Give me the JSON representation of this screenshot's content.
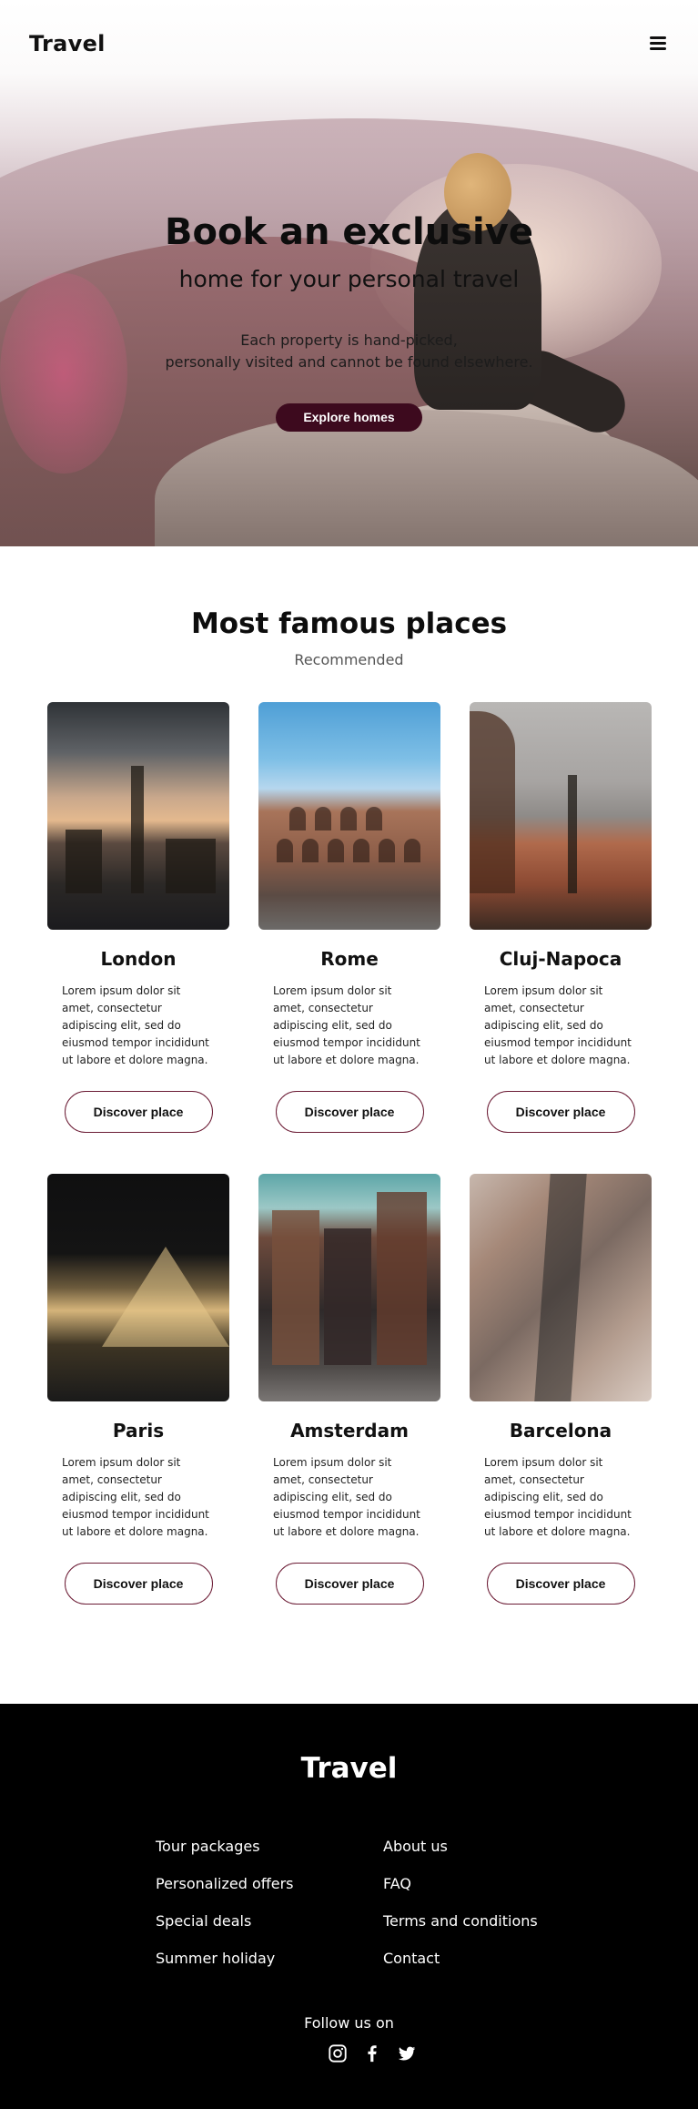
{
  "nav": {
    "logo": "Travel",
    "menu_icon": "hamburger-menu-icon"
  },
  "hero": {
    "title": "Book an exclusive",
    "subtitle": "home for your personal travel",
    "description_line1": "Each property is hand-picked,",
    "description_line2": "personally visited and cannot be found elsewhere.",
    "button": "Explore homes",
    "button_color": "#3d0a1e"
  },
  "places": {
    "title": "Most famous places",
    "subtitle": "Recommended",
    "cards": [
      {
        "name": "London",
        "text": "Lorem ipsum dolor sit amet, consectetur adipiscing elit, sed do eiusmod tempor incididunt ut labore et dolore magna.",
        "button": "Discover place"
      },
      {
        "name": "Rome",
        "text": "Lorem ipsum dolor sit amet, consectetur adipiscing elit, sed do eiusmod tempor incididunt ut labore et dolore magna.",
        "button": "Discover place"
      },
      {
        "name": "Cluj-Napoca",
        "text": "Lorem ipsum dolor sit amet, consectetur adipiscing elit, sed do eiusmod tempor incididunt ut labore et dolore magna.",
        "button": "Discover place"
      },
      {
        "name": "Paris",
        "text": "Lorem ipsum dolor sit amet, consectetur adipiscing elit, sed do eiusmod tempor incididunt ut labore et dolore magna.",
        "button": "Discover place"
      },
      {
        "name": "Amsterdam",
        "text": "Lorem ipsum dolor sit amet, consectetur adipiscing elit, sed do eiusmod tempor incididunt ut labore et dolore magna.",
        "button": "Discover place"
      },
      {
        "name": "Barcelona",
        "text": "Lorem ipsum dolor sit amet, consectetur adipiscing elit, sed do eiusmod tempor incididunt ut labore et dolore magna.",
        "button": "Discover place"
      }
    ]
  },
  "footer": {
    "logo": "Travel",
    "links_left": [
      "Tour packages",
      "Personalized offers",
      "Special deals",
      "Summer holiday"
    ],
    "links_right": [
      "About us",
      "FAQ",
      "Terms and conditions",
      "Contact"
    ],
    "follow_label": "Follow us on",
    "social_icons": [
      "instagram-icon",
      "facebook-icon",
      "twitter-icon"
    ]
  }
}
